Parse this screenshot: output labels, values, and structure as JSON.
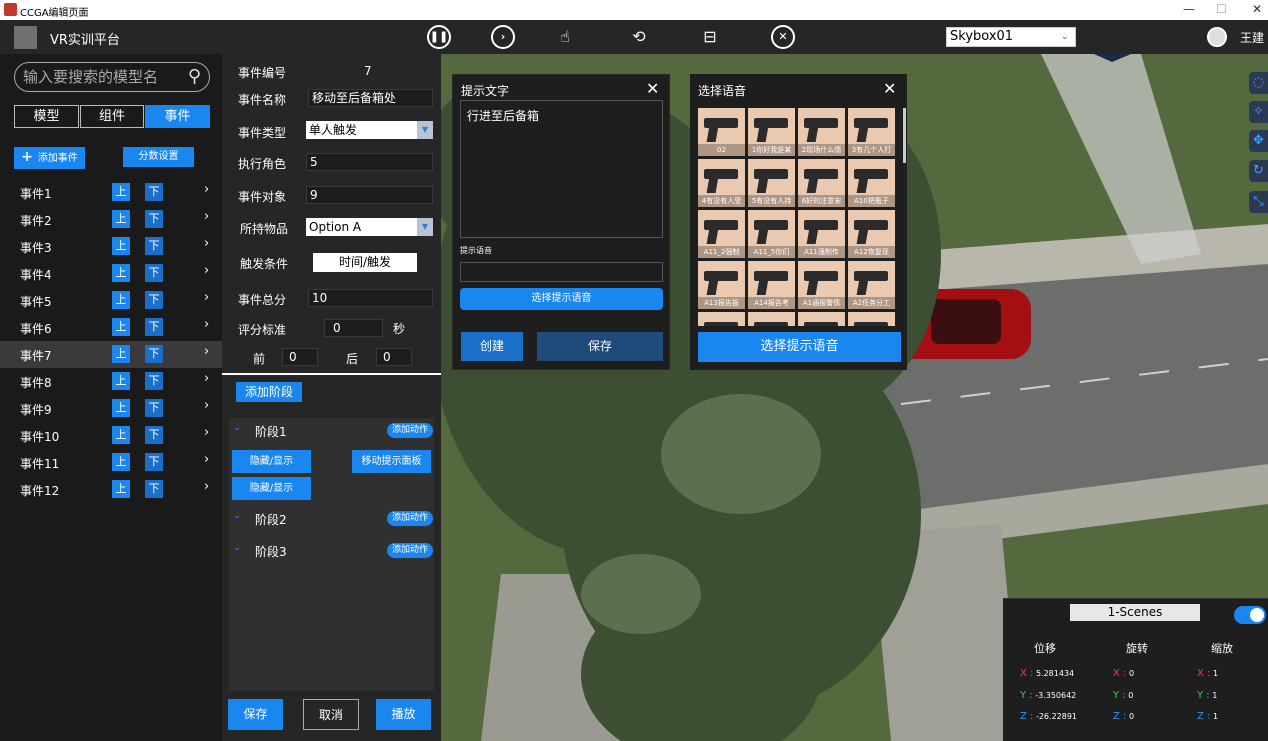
{
  "window": {
    "title": "CCGA编辑页面",
    "controls": [
      "—",
      "☐",
      "✕"
    ]
  },
  "topbar": {
    "app_name": "VR实训平台",
    "skybox": "Skybox01",
    "user": "王建",
    "icons": [
      "pause-icon",
      "next-icon",
      "pointer-icon",
      "camera-rotate-icon",
      "save-icon",
      "close-icon"
    ]
  },
  "left": {
    "search_placeholder": "输入要搜索的模型名",
    "tabs": [
      "模型",
      "组件",
      "事件"
    ],
    "add_event": "添加事件",
    "score_settings": "分数设置",
    "events": [
      {
        "label": "事件1",
        "up": "上",
        "down": "下"
      },
      {
        "label": "事件2",
        "up": "上",
        "down": "下"
      },
      {
        "label": "事件3",
        "up": "上",
        "down": "下"
      },
      {
        "label": "事件4",
        "up": "上",
        "down": "下"
      },
      {
        "label": "事件5",
        "up": "上",
        "down": "下"
      },
      {
        "label": "事件6",
        "up": "上",
        "down": "下"
      },
      {
        "label": "事件7",
        "up": "上",
        "down": "下"
      },
      {
        "label": "事件8",
        "up": "上",
        "down": "下"
      },
      {
        "label": "事件9",
        "up": "上",
        "down": "下"
      },
      {
        "label": "事件10",
        "up": "上",
        "down": "下"
      },
      {
        "label": "事件11",
        "up": "上",
        "down": "下"
      },
      {
        "label": "事件12",
        "up": "上",
        "down": "下"
      }
    ],
    "selected_event": "事件7"
  },
  "event_form": {
    "id_label": "事件编号",
    "id_value": "7",
    "name_label": "事件名称",
    "name_value": "移动至后备箱处",
    "type_label": "事件类型",
    "type_value": "单人触发",
    "role_label": "执行角色",
    "role_value": "5",
    "target_label": "事件对象",
    "target_value": "9",
    "item_label": "所持物品",
    "item_value": "Option A",
    "trigger_label": "触发条件",
    "trigger_value": "时间/触发",
    "score_label": "事件总分",
    "score_value": "10",
    "criteria_label": "评分标准",
    "criteria_value": "0",
    "criteria_unit": "秒",
    "before_label": "前",
    "before_value": "0",
    "after_label": "后",
    "after_value": "0"
  },
  "stages": {
    "add_stage": "添加阶段",
    "add_action": "添加动作",
    "list": [
      {
        "name": "阶段1",
        "actions": [
          "隐藏/显示",
          "移动提示面板",
          "隐藏/显示"
        ]
      },
      {
        "name": "阶段2",
        "actions": []
      },
      {
        "name": "阶段3",
        "actions": []
      }
    ]
  },
  "bottom_buttons": {
    "save": "保存",
    "cancel": "取消",
    "play": "播放"
  },
  "tip_dialog": {
    "title": "提示文字",
    "text": "行进至后备箱",
    "voice_label": "提示语音",
    "voice_value": "",
    "select_voice": "选择提示语音",
    "create": "创建",
    "save": "保存"
  },
  "voice_dialog": {
    "title": "选择语音",
    "items": [
      "02",
      "1你好我是某",
      "2现场什么情",
      "3有几个人打",
      "4有没有人受",
      "5有没有人持",
      "6好的注意安",
      "A10把瓶子",
      "A11_2强制",
      "A11_5你们",
      "A11强制传",
      "A12恢复现",
      "A13报告报",
      "A14报告考",
      "A1通报警情",
      "A2任务分工",
      "",
      "",
      "",
      ""
    ],
    "confirm": "选择提示语音"
  },
  "transform_panel": {
    "scene": "1-Scenes",
    "toggle_on": true,
    "headers": [
      "位移",
      "旋转",
      "缩放"
    ],
    "position": {
      "x": "5.281434",
      "y": "-3.350642",
      "z": "-26.22891"
    },
    "rotation": {
      "x": "0",
      "y": "0",
      "z": "0"
    },
    "scale": {
      "x": "1",
      "y": "1",
      "z": "1"
    },
    "axes": {
      "x": "X :",
      "y": "Y :",
      "z": "Z :"
    }
  },
  "colors": {
    "accent": "#1a87f0",
    "panel": "#262626",
    "sidebar": "#1a1a1a",
    "axis_x": "#ff3b3b",
    "axis_y": "#3bd43b",
    "axis_z": "#2f8fff"
  }
}
